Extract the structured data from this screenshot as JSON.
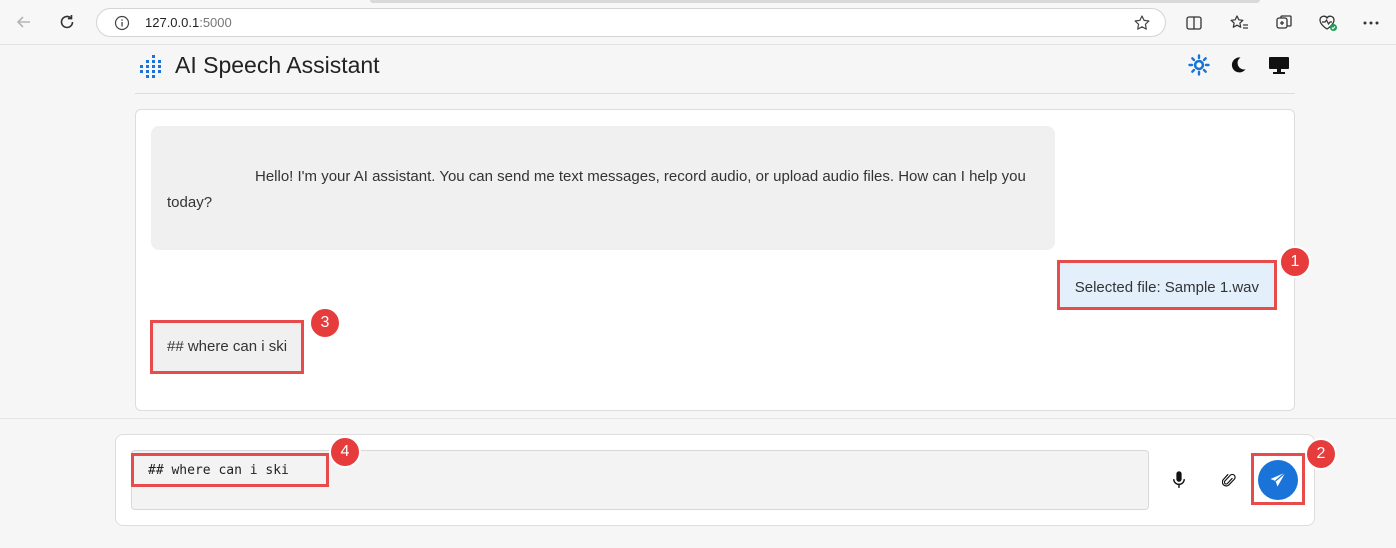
{
  "browser": {
    "url_host": "127.0.0.1",
    "url_port": ":5000"
  },
  "header": {
    "title": "AI Speech Assistant",
    "accent_color": "#1a73d9"
  },
  "chat": {
    "messages": [
      {
        "role": "assistant",
        "text": "Hello! I'm your AI assistant. You can send me text messages, record audio, or upload audio files. How can I help you today?"
      },
      {
        "role": "user",
        "text": "Selected file: Sample 1.wav"
      },
      {
        "role": "assistant",
        "text": "## where can i ski"
      }
    ]
  },
  "composer": {
    "value": "## where can i ski"
  },
  "annotations": {
    "badge1": "1",
    "badge2": "2",
    "badge3": "3",
    "badge4": "4",
    "color": "#e84b4b"
  }
}
